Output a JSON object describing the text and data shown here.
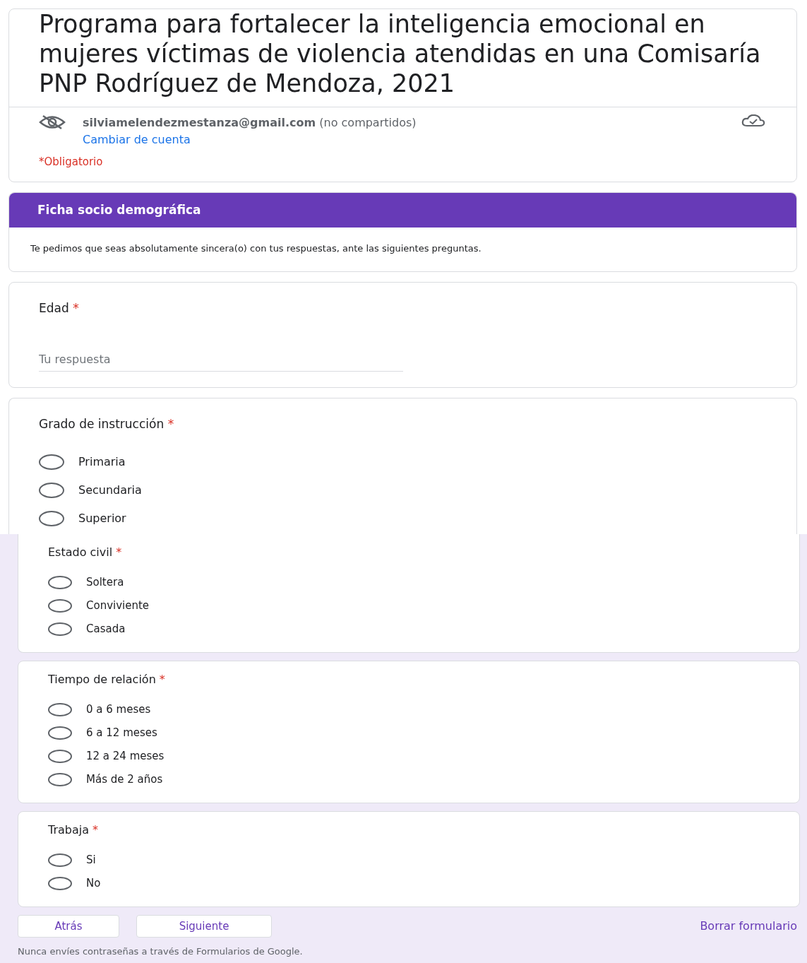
{
  "form": {
    "title": "Programa para fortalecer la inteligencia emocional en mujeres víctimas de violencia atendidas en una Comisaría PNP Rodríguez de Mendoza, 2021",
    "account": {
      "email": "silviamelendezmestanza@gmail.com",
      "note": "(no compartidos)",
      "switch_link": "Cambiar de cuenta"
    },
    "required_note": "*Obligatorio"
  },
  "section": {
    "title": "Ficha socio demográfica",
    "description": "Te pedimos que seas absolutamente sincera(o) con tus respuestas, ante las siguientes preguntas."
  },
  "upper_questions": [
    {
      "kind": "text",
      "title": "Edad",
      "required_mark": "*",
      "placeholder": "Tu respuesta"
    },
    {
      "kind": "radio",
      "title": "Grado de instrucción",
      "required_mark": "*",
      "options": [
        {
          "label": "Primaria",
          "selected": false
        },
        {
          "label": "Secundaria",
          "selected": false
        },
        {
          "label": "Superior",
          "selected": false
        }
      ]
    }
  ],
  "lower_questions": [
    {
      "kind": "radio",
      "title": "Estado civil",
      "required_mark": "*",
      "options": [
        {
          "label": "Soltera",
          "selected": false
        },
        {
          "label": "Conviviente",
          "selected": false
        },
        {
          "label": "Casada",
          "selected": false
        }
      ]
    },
    {
      "kind": "radio",
      "title": "Tiempo de relación",
      "required_mark": "*",
      "options": [
        {
          "label": "0 a 6 meses",
          "selected": false
        },
        {
          "label": "6 a 12 meses",
          "selected": false
        },
        {
          "label": "12 a 24 meses",
          "selected": false
        },
        {
          "label": "Más de 2 años",
          "selected": false
        }
      ]
    },
    {
      "kind": "radio",
      "title": "Trabaja",
      "required_mark": "*",
      "options": [
        {
          "label": "Si",
          "selected": false
        },
        {
          "label": "No",
          "selected": false
        }
      ]
    }
  ],
  "buttons": {
    "back": "Atrás",
    "next": "Siguiente",
    "clear": "Borrar formulario"
  },
  "footer": "Nunca envíes contraseñas a través de Formularios de Google."
}
